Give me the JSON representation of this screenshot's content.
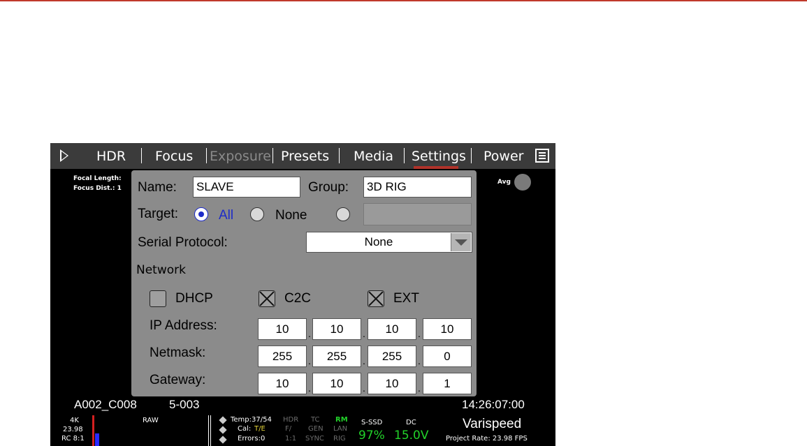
{
  "menu": {
    "items": [
      {
        "label": "HDR",
        "state": "normal"
      },
      {
        "label": "Focus",
        "state": "normal"
      },
      {
        "label": "Exposure",
        "state": "disabled"
      },
      {
        "label": "Presets",
        "state": "normal"
      },
      {
        "label": "Media",
        "state": "normal"
      },
      {
        "label": "Settings",
        "state": "selected"
      },
      {
        "label": "Power",
        "state": "normal"
      }
    ]
  },
  "overlay": {
    "focal_length": "Focal Length:",
    "focus_dist": "Focus Dist.: 1",
    "avg": "Avg"
  },
  "panel": {
    "name_label": "Name:",
    "name_value": "SLAVE",
    "group_label": "Group:",
    "group_value": "3D RIG",
    "target_label": "Target:",
    "target_all": "All",
    "target_none": "None",
    "serial_label": "Serial Protocol:",
    "serial_value": "None",
    "network_label": "Network",
    "dhcp_label": "DHCP",
    "c2c_label": "C2C",
    "ext_label": "EXT",
    "ip_label": "IP Address:",
    "netmask_label": "Netmask:",
    "gateway_label": "Gateway:",
    "ip": [
      "10",
      "10",
      "10",
      "10"
    ],
    "netmask": [
      "255",
      "255",
      "255",
      "0"
    ],
    "gateway": [
      "10",
      "10",
      "10",
      "1"
    ],
    "dot": "."
  },
  "clip": {
    "name": "A002_C008",
    "scene": "5-003",
    "timecode": "14:26:07:00"
  },
  "status": {
    "res": "4K",
    "fps": "23.98",
    "rc": "RC 8:1",
    "raw": "RAW",
    "temp": "Temp:37/54",
    "cal": "Cal:",
    "cal_val": "T/E",
    "errors": "Errors:0",
    "hdr": "HDR",
    "f": "F/",
    "ratio": "1:1",
    "tc": "TC",
    "gen": "GEN",
    "sync": "SYNC",
    "rm": "RM",
    "lan": "LAN",
    "rig": "RIG",
    "media": "S-SSD",
    "media_pct": "97%",
    "power_src": "DC",
    "voltage": "15.0V",
    "varispeed": "Varispeed",
    "project_rate": "Project Rate: 23.98 FPS"
  }
}
